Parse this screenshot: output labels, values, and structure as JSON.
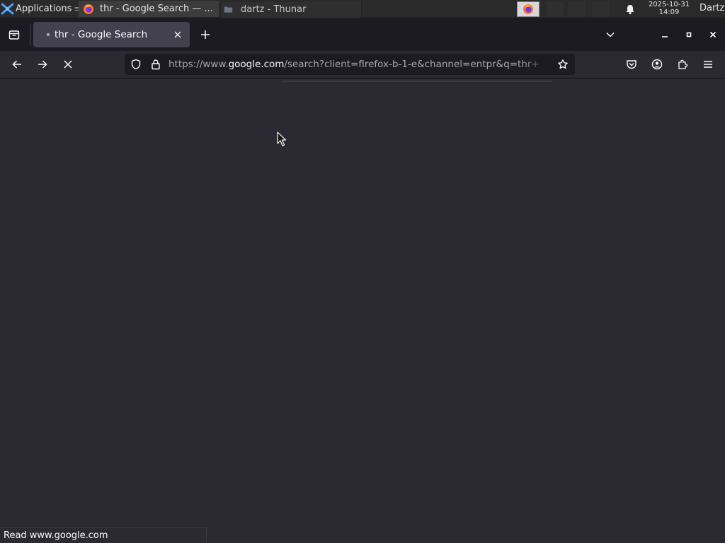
{
  "panel": {
    "applications_label": "Applications",
    "applications_icon": "xfce-logo-icon",
    "tasks": [
      {
        "title": "thr - Google Search — ...",
        "icon": "firefox-icon",
        "active": true
      },
      {
        "title": "dartz - Thunar",
        "icon": "folder-icon",
        "active": false
      }
    ],
    "clock_date": "2025-10-31",
    "clock_time": "14:09",
    "user": "Dartz"
  },
  "browser": {
    "tab_title": "thr - Google Search",
    "url_prefix": "https://www.",
    "url_domain": "google.com",
    "url_suffix": "/search?client=firefox-b-1-e&channel=entpr&q=thr+",
    "status_text": "Read www.google.com"
  },
  "colors": {
    "accent_firefox": "#ff7139",
    "background": "#2b2a33",
    "toolbar_field": "#1c1b22"
  }
}
